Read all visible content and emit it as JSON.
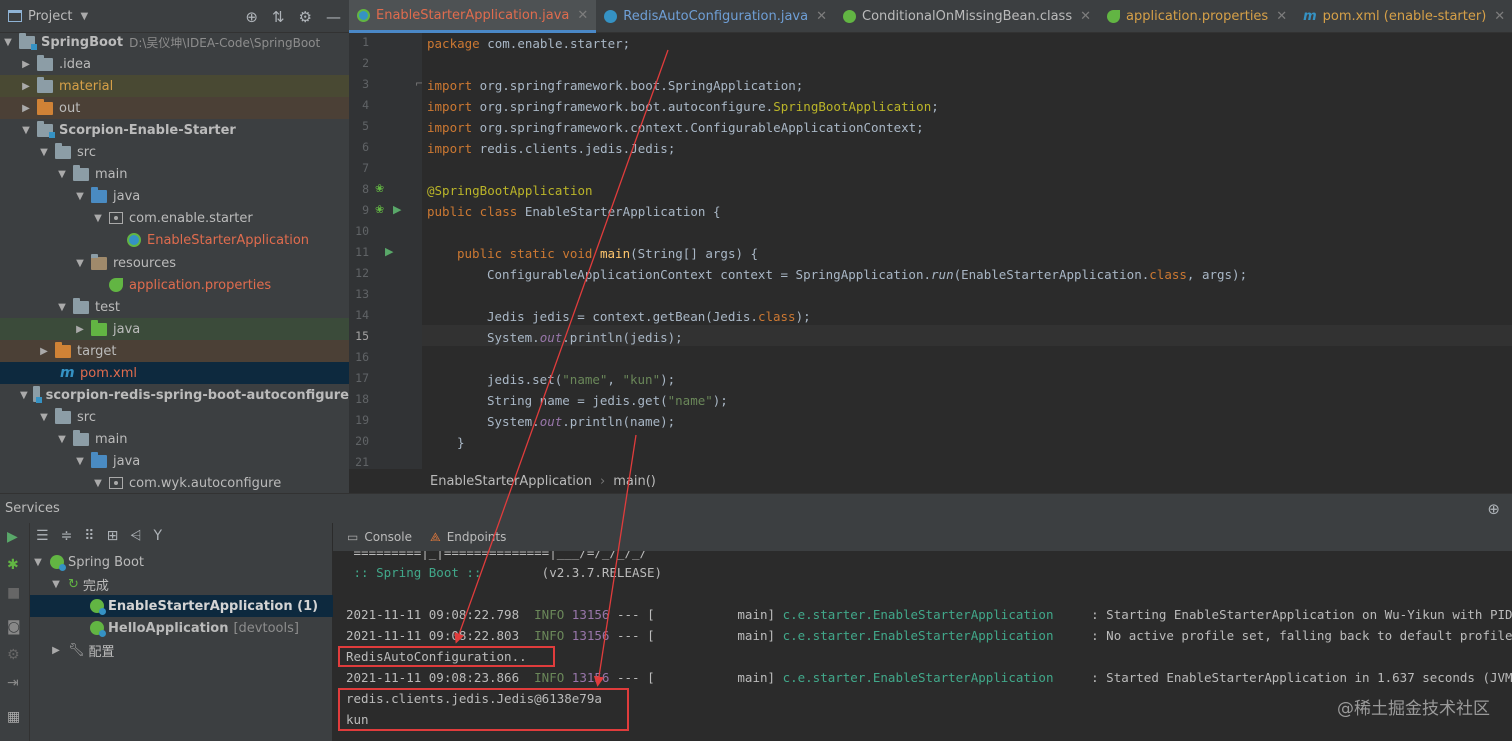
{
  "project_panel": {
    "title": "Project",
    "rows": [
      {
        "label": "SpringBoot",
        "path": "D:\\吴仪坤\\IDEA-Code\\SpringBoot",
        "bold": true
      },
      {
        "label": ".idea"
      },
      {
        "label": "material"
      },
      {
        "label": "out"
      },
      {
        "label": "Scorpion-Enable-Starter",
        "bold": true
      },
      {
        "label": "src"
      },
      {
        "label": "main"
      },
      {
        "label": "java"
      },
      {
        "label": "com.enable.starter"
      },
      {
        "label": "EnableStarterApplication"
      },
      {
        "label": "resources"
      },
      {
        "label": "application.properties"
      },
      {
        "label": "test"
      },
      {
        "label": "java"
      },
      {
        "label": "target"
      },
      {
        "label": "pom.xml"
      },
      {
        "label": "scorpion-redis-spring-boot-autoconfigure",
        "bold": true
      },
      {
        "label": "src"
      },
      {
        "label": "main"
      },
      {
        "label": "java"
      },
      {
        "label": "com.wyk.autoconfigure"
      }
    ]
  },
  "editor_tabs": [
    {
      "label": "EnableStarterApplication.java",
      "active": true
    },
    {
      "label": "RedisAutoConfiguration.java"
    },
    {
      "label": "ConditionalOnMissingBean.class"
    },
    {
      "label": "application.properties"
    },
    {
      "label": "pom.xml (enable-starter)"
    }
  ],
  "editor": {
    "line_numbers": [
      "1",
      "2",
      "3",
      "4",
      "5",
      "6",
      "7",
      "8",
      "9",
      "10",
      "11",
      "12",
      "13",
      "14",
      "15",
      "16",
      "17",
      "18",
      "19",
      "20",
      "21"
    ],
    "current_line": "15",
    "code": {
      "l1_kw": "package",
      "l1_rest": " com.enable.starter;",
      "l3_kw": "import",
      "l3_rest": " org.springframework.boot.SpringApplication;",
      "l4_kw": "import",
      "l4_rest": " org.springframework.boot.autoconfigure.",
      "l4_ann": "SpringBootApplication",
      "l4_end": ";",
      "l5_kw": "import",
      "l5_rest": " org.springframework.context.ConfigurableApplicationContext;",
      "l6_kw": "import",
      "l6_rest": " redis.clients.jedis.Jedis;",
      "l8_ann": "@SpringBootApplication",
      "l9_kw": "public class",
      "l9_rest": " EnableStarterApplication {",
      "l11_kw": "public static void",
      "l11_fn": "main",
      "l11_rest": "(String[] args) {",
      "l12_a": "ConfigurableApplicationContext context = SpringApplication.",
      "l12_it": "run",
      "l12_b": "(EnableStarterApplication.",
      "l12_kw": "class",
      "l12_c": ", args);",
      "l14_a": "Jedis jedis = context.getBean(Jedis.",
      "l14_kw": "class",
      "l14_c": ");",
      "l15_a": "System.",
      "l15_st": "out",
      "l15_b": ".println(jedis);",
      "l17_a": "jedis.set(",
      "l17_s1": "\"name\"",
      "l17_b": ", ",
      "l17_s2": "\"kun\"",
      "l17_c": ");",
      "l18_a": "String name = jedis.get(",
      "l18_s": "\"name\"",
      "l18_b": ");",
      "l19_a": "System.",
      "l19_st": "out",
      "l19_b": ".println(name);",
      "l20": "}"
    }
  },
  "breadcrumb": {
    "class": "EnableStarterApplication",
    "method": "main()"
  },
  "services": {
    "title": "Services",
    "tree": [
      {
        "label": "Spring Boot"
      },
      {
        "label": "完成"
      },
      {
        "label": "EnableStarterApplication (1)",
        "selected": true
      },
      {
        "label": "HelloApplication",
        "suffix": "[devtools]"
      },
      {
        "label": "配置"
      }
    ]
  },
  "console_tabs": [
    {
      "label": "Console"
    },
    {
      "label": "Endpoints"
    }
  ],
  "console": {
    "banner_line": " =========|_|==============|___/=/_/_/_/",
    "spring_boot": " :: Spring Boot ::",
    "version": "        (v2.3.7.RELEASE)",
    "logs": [
      {
        "time": "2021-11-11 09:08:22.798",
        "level": "INFO",
        "pid": "13156",
        "sep": "--- [",
        "thread": "           main]",
        "logger": "c.e.starter.EnableStarterApplication",
        "msg": "     : Starting EnableStarterApplication on Wu-Yikun with PID"
      },
      {
        "time": "2021-11-11 09:08:22.803",
        "level": "INFO",
        "pid": "13156",
        "sep": "--- [",
        "thread": "           main]",
        "logger": "c.e.starter.EnableStarterApplication",
        "msg": "     : No active profile set, falling back to default profile"
      },
      {
        "time": "2021-11-11 09:08:23.866",
        "level": "INFO",
        "pid": "13156",
        "sep": "--- [",
        "thread": "           main]",
        "logger": "c.e.starter.EnableStarterApplication",
        "msg": "     : Started EnableStarterApplication in 1.637 seconds (JVM"
      }
    ],
    "redis_line": "RedisAutoConfiguration..",
    "jedis_line": "redis.clients.jedis.Jedis@6138e79a",
    "kun_line": "kun"
  },
  "watermark": "@稀土掘金技术社区",
  "colors": {
    "accent": "#4a88c7",
    "annotation_red": "#e03c3c",
    "selection": "#0d293e"
  }
}
